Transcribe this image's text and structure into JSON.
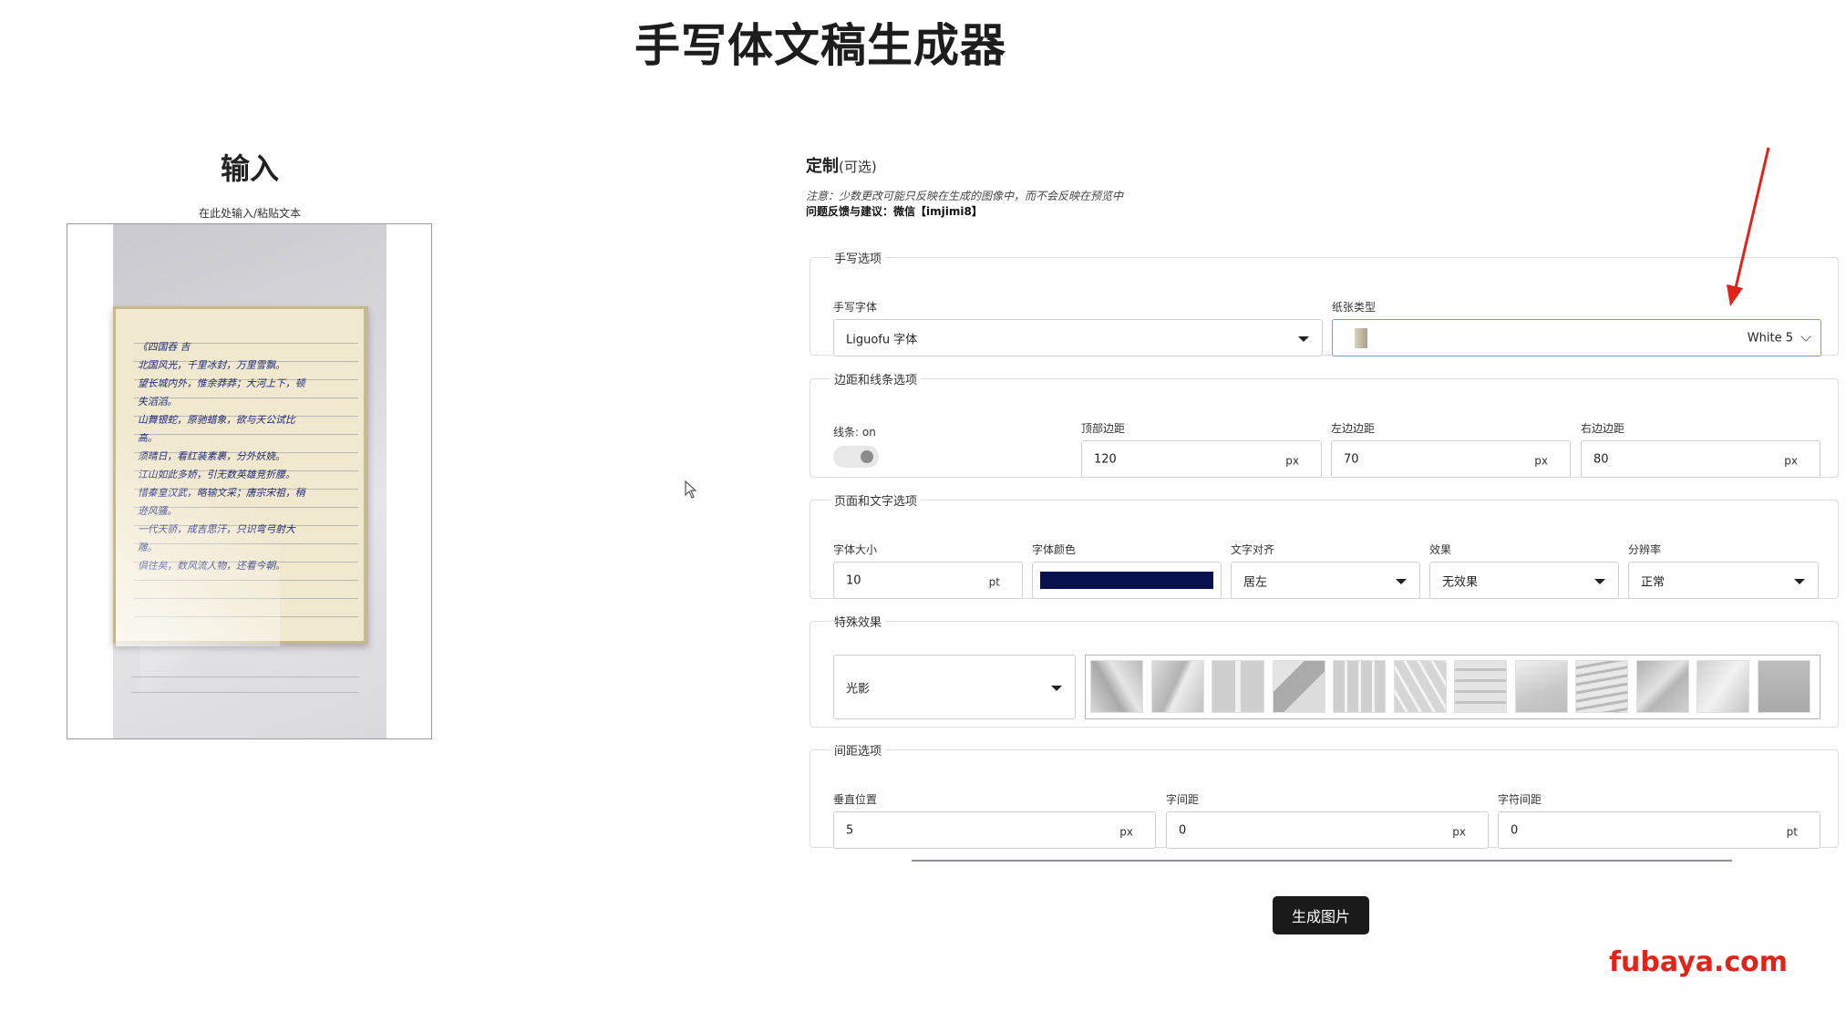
{
  "page": {
    "title": "手写体文稿生成器"
  },
  "input": {
    "heading": "输入",
    "hint": "在此处输入/粘贴文本",
    "preview_lines": [
      "《四国吞 吉",
      "北国风光，千里冰封，万里雪飘。",
      "望长城内外，惟余莽莽；大河上下，顿",
      "失滔滔。",
      "山舞银蛇，原驰蜡象，欲与天公试比",
      "高。",
      "须晴日，看红装素裹，分外妖娆。",
      "江山如此多娇，引无数英雄竞折腰。",
      "惜秦皇汉武，略输文采；唐宗宋祖，稍",
      "逊风骚。",
      "一代天骄，成吉思汗，只识弯弓射大",
      "雕。",
      "俱往矣，数风流人物，还看今朝。"
    ]
  },
  "customize": {
    "title": "定制",
    "optional": "(可选)",
    "notice": "注意：少数更改可能只反映在生成的图像中，而不会反映在预览中",
    "feedback": "问题反馈与建议：微信【imjimi8】"
  },
  "handwriting": {
    "legend": "手写选项",
    "font_label": "手写字体",
    "font_value": "Liguofu 字体",
    "paper_label": "纸张类型",
    "paper_value": "White 5"
  },
  "margins": {
    "legend": "边距和线条选项",
    "lines_label": "线条: on",
    "top_label": "顶部边距",
    "top_value": "120",
    "top_unit": "px",
    "left_label": "左边边距",
    "left_value": "70",
    "left_unit": "px",
    "right_label": "右边边距",
    "right_value": "80",
    "right_unit": "px"
  },
  "page_text": {
    "legend": "页面和文字选项",
    "size_label": "字体大小",
    "size_value": "10",
    "size_unit": "pt",
    "color_label": "字体颜色",
    "color_value": "#0a1150",
    "align_label": "文字对齐",
    "align_value": "居左",
    "effect_label": "效果",
    "effect_value": "无效果",
    "resolution_label": "分辨率",
    "resolution_value": "正常"
  },
  "special": {
    "legend": "特殊效果",
    "select_value": "光影",
    "thumbnail_count": 12
  },
  "spacing": {
    "legend": "间距选项",
    "vertical_label": "垂直位置",
    "vertical_value": "5",
    "vertical_unit": "px",
    "word_label": "字间距",
    "word_value": "0",
    "word_unit": "px",
    "char_label": "字符间距",
    "char_value": "0",
    "char_unit": "pt"
  },
  "actions": {
    "generate": "生成图片"
  },
  "watermark": "fubaya.com",
  "colors": {
    "accent_arrow": "#e2231a",
    "button_bg": "#1a1a1a",
    "paper_select_border": "#7b9bd1"
  }
}
